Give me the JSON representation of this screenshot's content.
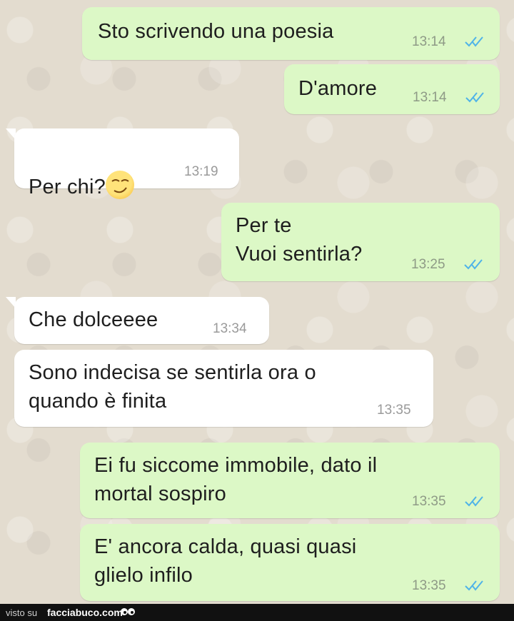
{
  "messages": [
    {
      "direction": "out",
      "text": "Sto scrivendo una poesia",
      "time": "13:14",
      "status": "read"
    },
    {
      "direction": "out",
      "text": "D'amore",
      "time": "13:14",
      "status": "read"
    },
    {
      "direction": "in",
      "text": "Per chi?",
      "emoji": "smirk-face-icon",
      "time": "13:19"
    },
    {
      "direction": "out",
      "text": "Per te\nVuoi sentirla?",
      "time": "13:25",
      "status": "read"
    },
    {
      "direction": "in",
      "text": "Che dolceeee",
      "time": "13:34"
    },
    {
      "direction": "in",
      "text": "Sono indecisa se sentirla ora o\nquando è finita",
      "time": "13:35"
    },
    {
      "direction": "out",
      "text": "Ei fu siccome immobile, dato il\nmortal sospiro",
      "time": "13:35",
      "status": "read"
    },
    {
      "direction": "out",
      "text": "E' ancora calda, quasi quasi\nglielo infilo",
      "time": "13:35",
      "status": "read"
    }
  ],
  "footer": {
    "prefix": "visto su",
    "brand": "facciabuco.com",
    "logo": "eyes-icon"
  },
  "colors": {
    "outgoing_bubble": "#dcf8c6",
    "incoming_bubble": "#ffffff",
    "read_ticks": "#4fb3e8",
    "background": "#e3dccf"
  }
}
